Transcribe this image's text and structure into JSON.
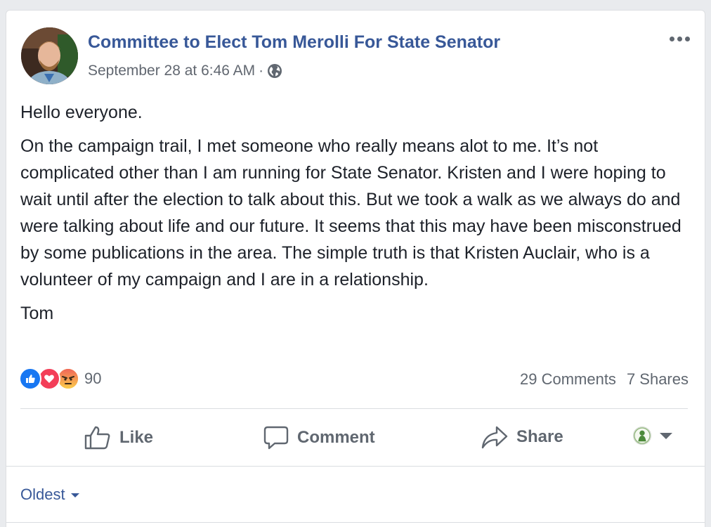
{
  "post": {
    "author": "Committee to Elect Tom Merolli For State Senator",
    "timestamp": "September 28 at 6:46 AM",
    "separator": "·",
    "audience_icon": "globe-icon",
    "paragraphs": [
      "Hello everyone.",
      "On the campaign trail, I met someone who really means alot to me. It’s not complicated other than I am running for State Senator. Kristen and I were hoping to wait until after the election to talk about this. But we took a walk as we always do and were talking about life and our future. It seems that this may have been misconstrued by some publications in the area. The simple truth is that Kristen Auclair, who is a volunteer of my campaign and I are in a relationship.",
      "Tom"
    ]
  },
  "engagement": {
    "reactions": [
      "like-reaction-icon",
      "love-reaction-icon",
      "angry-reaction-icon"
    ],
    "reaction_count": "90",
    "comments": "29 Comments",
    "shares": "7 Shares"
  },
  "actions": {
    "like": "Like",
    "comment": "Comment",
    "share": "Share"
  },
  "comments_section": {
    "sort_label": "Oldest"
  },
  "colors": {
    "link_blue": "#385898",
    "like_blue": "#1877f2",
    "love_red": "#f33e58",
    "angry_orange": "#f7b125",
    "muted_gray": "#606770"
  }
}
